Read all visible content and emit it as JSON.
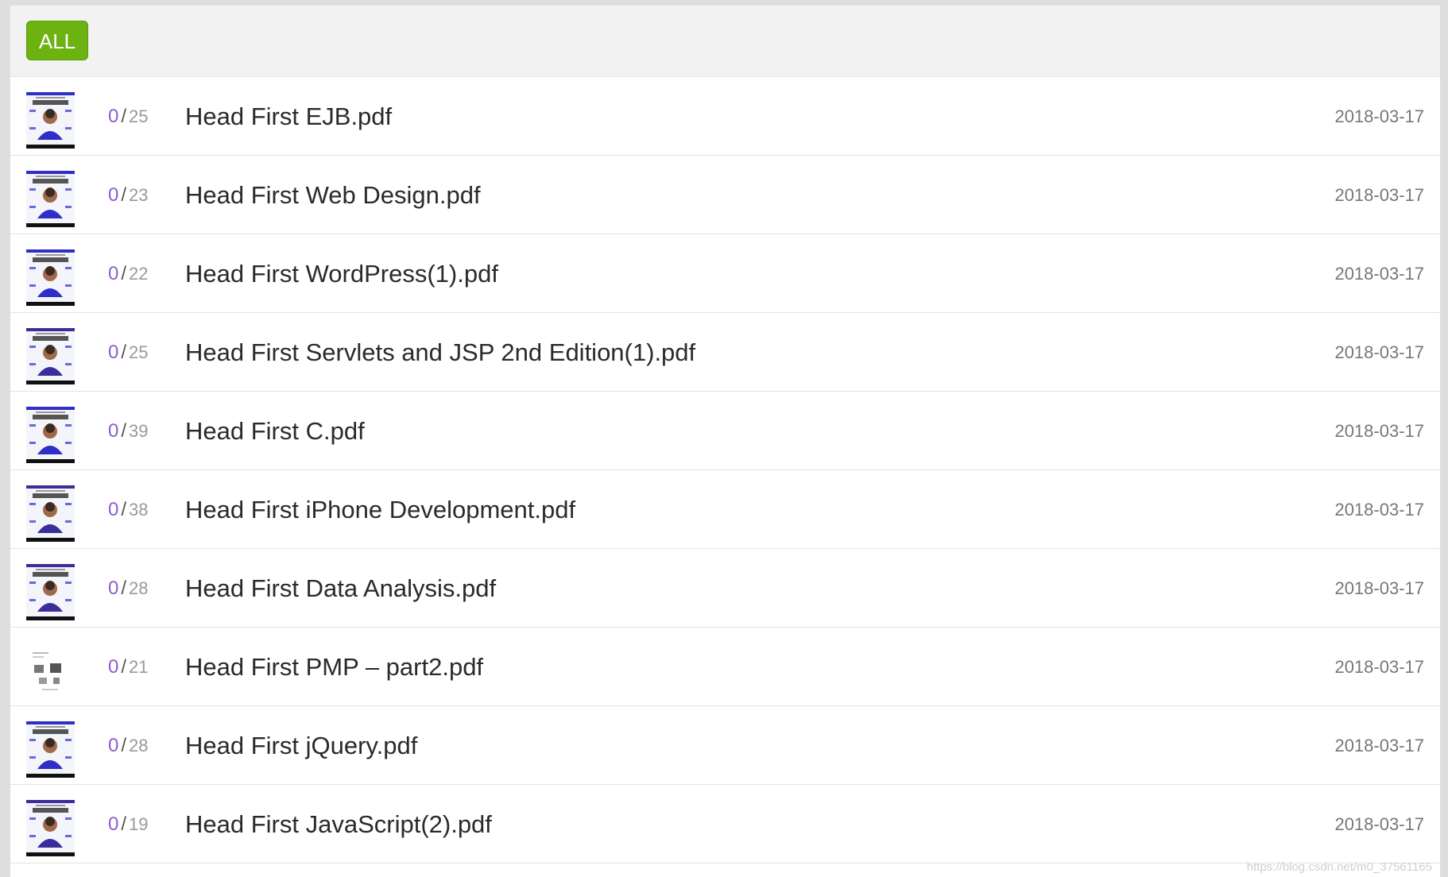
{
  "toolbar": {
    "filter_label": "ALL"
  },
  "files": [
    {
      "read": "0",
      "total": "25",
      "name": "Head First EJB.pdf",
      "date": "2018-03-17",
      "cover": "head-first-cover-icon",
      "cover_color": "#2f2fc8"
    },
    {
      "read": "0",
      "total": "23",
      "name": "Head First Web Design.pdf",
      "date": "2018-03-17",
      "cover": "head-first-cover-icon",
      "cover_color": "#2f2fc8"
    },
    {
      "read": "0",
      "total": "22",
      "name": "Head First WordPress(1).pdf",
      "date": "2018-03-17",
      "cover": "head-first-cover-icon",
      "cover_color": "#2f2fc8"
    },
    {
      "read": "0",
      "total": "25",
      "name": "Head First Servlets and JSP 2nd Edition(1).pdf",
      "date": "2018-03-17",
      "cover": "head-first-cover-icon",
      "cover_color": "#3a2f9a"
    },
    {
      "read": "0",
      "total": "39",
      "name": "Head First C.pdf",
      "date": "2018-03-17",
      "cover": "head-first-cover-icon",
      "cover_color": "#2f2fc8"
    },
    {
      "read": "0",
      "total": "38",
      "name": "Head First iPhone Development.pdf",
      "date": "2018-03-17",
      "cover": "head-first-cover-icon",
      "cover_color": "#3a2f9a"
    },
    {
      "read": "0",
      "total": "28",
      "name": "Head First Data Analysis.pdf",
      "date": "2018-03-17",
      "cover": "head-first-cover-icon",
      "cover_color": "#3a2f9a"
    },
    {
      "read": "0",
      "total": "21",
      "name": "Head First PMP – part2.pdf",
      "date": "2018-03-17",
      "cover": "document-page-icon",
      "cover_color": "#ffffff"
    },
    {
      "read": "0",
      "total": "28",
      "name": "Head First jQuery.pdf",
      "date": "2018-03-17",
      "cover": "head-first-cover-icon",
      "cover_color": "#2f2fc8"
    },
    {
      "read": "0",
      "total": "19",
      "name": "Head First JavaScript(2).pdf",
      "date": "2018-03-17",
      "cover": "head-first-cover-icon",
      "cover_color": "#3a2f9a"
    }
  ],
  "watermark": "https://blog.csdn.net/m0_37561165",
  "colors": {
    "accent_green": "#6cb312",
    "read_count_purple": "#8e5bd0"
  }
}
